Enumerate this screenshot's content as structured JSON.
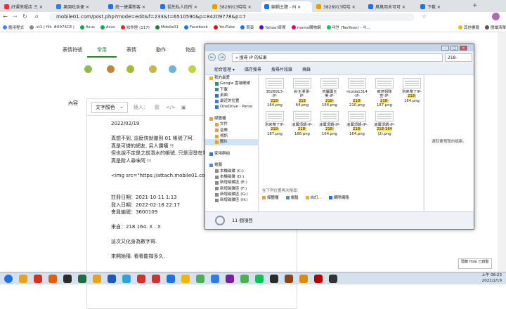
{
  "browser": {
    "tabs": [
      {
        "label": "好運來喔店 三 ✕",
        "color": "#e3342f",
        "active": false
      },
      {
        "label": "果園吃食便 ✕",
        "color": "#2b7de9",
        "active": false
      },
      {
        "label": "統一捷運新客 ✕",
        "color": "#1a73e8",
        "active": false
      },
      {
        "label": "祖先私人四所 ✕",
        "color": "#1a73e8",
        "active": false
      },
      {
        "label": "3828913哈哈 ✕",
        "color": "#f29900",
        "active": false
      },
      {
        "label": "編輯主題 - M ✕",
        "color": "#1a73e8",
        "active": true
      },
      {
        "label": "3828913哈哈 ✕",
        "color": "#f29900",
        "active": false
      },
      {
        "label": "萬萬用未可可 ✕",
        "color": "#1a73e8",
        "active": false
      },
      {
        "label": "下載 ✕",
        "color": "#1a73e8",
        "active": false
      }
    ],
    "new_tab": "+",
    "url": "mobile01.com/post.php?mode=edit&f=233&t=6510590&p=84209778&p=7",
    "bookmarks": [
      {
        "label": "應用程式",
        "color": "#4285f4"
      },
      {
        "label": ".st1 | filt: #0076CE |",
        "color": "#888"
      },
      {
        "label": "Asus",
        "color": "#0a5"
      },
      {
        "label": "Asus",
        "color": "#0a5"
      },
      {
        "label": "收件匣 (117)",
        "color": "#d93025"
      },
      {
        "label": "Mobile01",
        "color": "#188038"
      },
      {
        "label": "Facebook",
        "color": "#1877f2"
      },
      {
        "label": "YouTube",
        "color": "#ff0000"
      },
      {
        "label": "首頁",
        "color": "#1a73e8"
      },
      {
        "label": "Yahoo!奇摩",
        "color": "#6001d2"
      },
      {
        "label": "momo購物網",
        "color": "#e0006c"
      },
      {
        "label": "태연 (TaeYeon) - 사...",
        "color": "#03c75a"
      },
      {
        "label": "其他書籤",
        "color": "#f2b600"
      },
      {
        "label": "閱讀清單",
        "color": "#555"
      }
    ]
  },
  "page": {
    "emoji_tabs": [
      "表情符號",
      "常用",
      "表情",
      "動作",
      "物品"
    ],
    "emoji_colors": [
      "#8dbb4f",
      "#b98a3c",
      "#a8b935",
      "#c5b94a",
      "#6fb5d8",
      "#c3d142"
    ],
    "sidebar_label": "內容",
    "toolbar": {
      "text_color": "文字顏色",
      "insert": "插入："
    },
    "body_lines": [
      "2022/02/19",
      "",
      "真想不到, 這麼快就徹到 01 帳號了阿.",
      "真是可憐的網友, 另人讚嘆 !!",
      "但也說不定是之前潛水的帳號, 只是沒發在電腦版",
      "真是耐人尋味阿 !!",
      "",
      "<img src=\"https://attach.mobile01.com/attach/202",
      "",
      "",
      "註冊日期：2021-10-11 1:13",
      "登入日期：2022-02-18 22:17",
      "會員編號：3600109",
      "",
      "來自：218.164. X . X",
      "",
      "這次又化身為數字哥.",
      "",
      "來開始猜. 看看能撐多久."
    ]
  },
  "explorer": {
    "path": "搜尋 IP 的結果",
    "search": "218-",
    "commands": [
      "組合管理 ▾",
      "儲存搜尋",
      "搜尋片段錄",
      "燒錄"
    ],
    "nav": [
      {
        "label": "我的最愛",
        "color": "#f2b600"
      },
      {
        "label": "Google 雲端硬碟",
        "color": "#1a9e5c"
      },
      {
        "label": "下載",
        "color": "#4a7cc4"
      },
      {
        "label": "桌面",
        "color": "#3a6fb5"
      },
      {
        "label": "最近的位置",
        "color": "#4a7cc4"
      },
      {
        "label": "OneDrive - Perso",
        "color": "#2a7ad4"
      },
      {
        "label": "",
        "color": ""
      },
      {
        "label": "媒體櫃",
        "color": "#d9a441"
      },
      {
        "label": "文件",
        "color": "#d9a441"
      },
      {
        "label": "音樂",
        "color": "#d9a441"
      },
      {
        "label": "視訊",
        "color": "#d9a441"
      },
      {
        "label": "圖片",
        "color": "#d9a441"
      },
      {
        "label": "",
        "color": ""
      },
      {
        "label": "家用群組",
        "color": "#2a7ad4"
      },
      {
        "label": "",
        "color": ""
      },
      {
        "label": "電腦",
        "color": "#5a8ac4"
      },
      {
        "label": "本機磁碟 (C:)",
        "color": "#888"
      },
      {
        "label": "本機磁碟 (D:)",
        "color": "#888"
      },
      {
        "label": "新增磁碟區 (E:)",
        "color": "#888"
      },
      {
        "label": "新增磁碟區 (F:)",
        "color": "#888"
      },
      {
        "label": "新增磁碟區 (G:)",
        "color": "#888"
      },
      {
        "label": "新增磁碟區 (H:)",
        "color": "#888"
      },
      {
        "label": "",
        "color": ""
      }
    ],
    "files": [
      {
        "l1": "3828913-",
        "l2": "IP-",
        "l3": "218-",
        "l4": "164.png"
      },
      {
        "l1": "鈴主漫漫-",
        "l2": "IP-",
        "l3": "218",
        "l4": "64.png"
      },
      {
        "l1": "肉屬厲主",
        "l2": "美-IP-",
        "l3": "218-",
        "l4": "164.png"
      },
      {
        "l1": "mizda1314",
        "l2": "-IP-",
        "l3": "218-",
        "l4": "210.png"
      },
      {
        "l1": "被老姐隊",
        "l2": "查-IP-",
        "l3": "218-",
        "l4": "187.png"
      },
      {
        "l1": "別來幫了IP-",
        "l2": "",
        "l3": "218-",
        "l4": "164.png"
      },
      {
        "l1": "別來幫了IP-",
        "l2": "",
        "l3": "218-",
        "l4": "187.png"
      },
      {
        "l1": "凌厲頂鍋-IP-",
        "l2": "",
        "l3": "218-",
        "l4": "166.png"
      },
      {
        "l1": "凌厲頂鍋-IP-",
        "l2": "",
        "l3": "218-",
        "l4": "164.png"
      },
      {
        "l1": "凌厲頂鍋-IP-",
        "l2": "",
        "l3": "218-",
        "l4": "164.png"
      },
      {
        "l1": "凌厲頂鍋-IP-",
        "l2": "",
        "l3": "218-164",
        "l4": "(2).png"
      }
    ],
    "search_again": "在下列位置再次搜尋：",
    "search_locs": [
      "媒體櫃",
      "電腦",
      "自訂...",
      "網際網路"
    ],
    "preview": "選取要預覽的檔案。",
    "status": "11 個項目"
  },
  "taskbar": {
    "apps": [
      "#1a73e8",
      "#e8a317",
      "#d93025",
      "#e85d0c",
      "#2b2b2b",
      "#1d6f42",
      "#e8a317",
      "#185abd",
      "#2aa5d8",
      "#d93025",
      "#c33",
      "#1a73e8",
      "#f2b600",
      "#4caf50",
      "#2b7de9",
      "#7b1fa2",
      "#4caf50",
      "#06c755",
      "#2b2b2b",
      "#8b4513",
      "#e08a00",
      "#b00",
      "#333"
    ],
    "time": "上午 08:23",
    "date": "2022/2/19",
    "popup": "隱藏 Hide 已啟動"
  }
}
